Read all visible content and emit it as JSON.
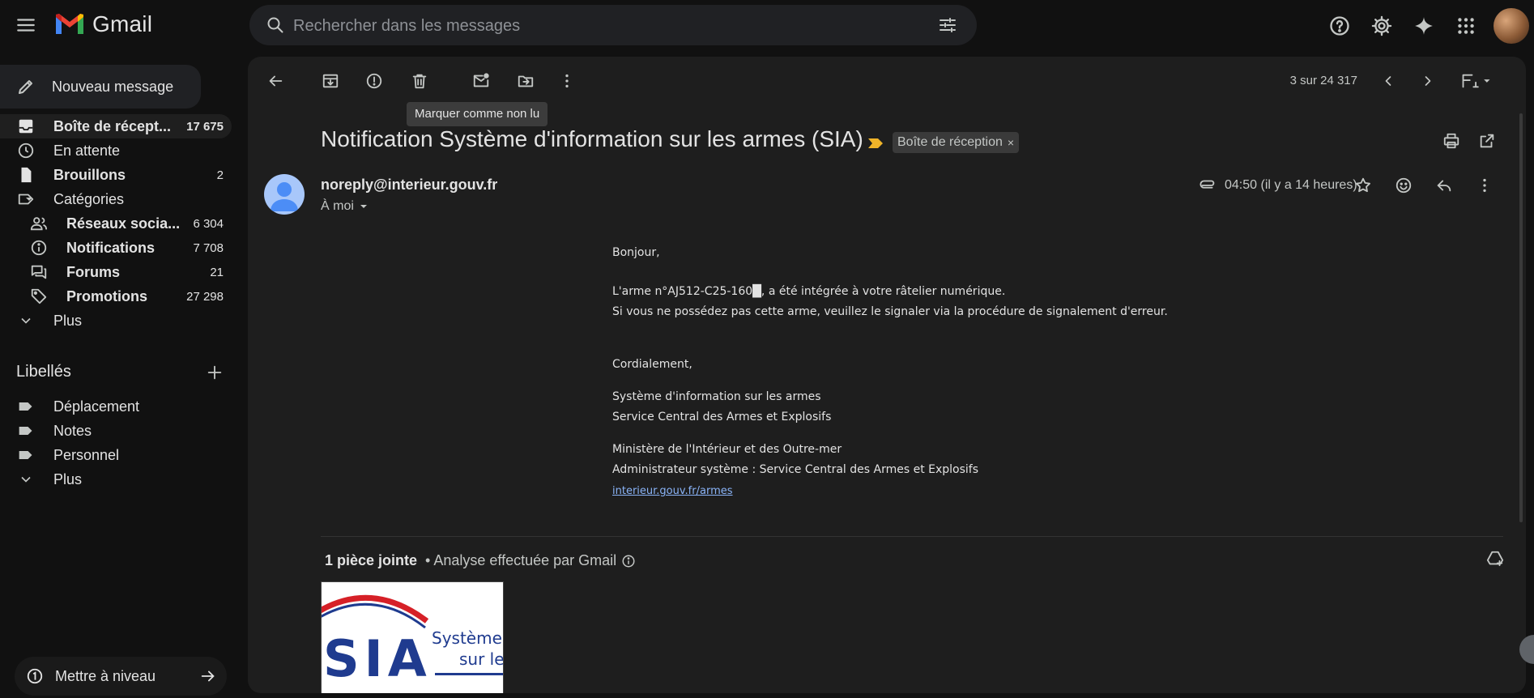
{
  "app": {
    "name": "Gmail"
  },
  "search": {
    "placeholder": "Rechercher dans les messages"
  },
  "sidebar": {
    "compose_label": "Nouveau message",
    "items": [
      {
        "label": "Boîte de récept...",
        "count": "17 675",
        "icon": "inbox-icon",
        "bold": true,
        "active": true
      },
      {
        "label": "En attente",
        "count": "",
        "icon": "clock-icon"
      },
      {
        "label": "Brouillons",
        "count": "2",
        "icon": "draft-icon",
        "bold": true
      },
      {
        "label": "Catégories",
        "count": "",
        "icon": "label-icon"
      },
      {
        "label": "Réseaux socia...",
        "count": "6 304",
        "icon": "people-icon",
        "bold": true
      },
      {
        "label": "Notifications",
        "count": "7 708",
        "icon": "info-icon",
        "bold": true
      },
      {
        "label": "Forums",
        "count": "21",
        "icon": "forum-icon",
        "bold": true
      },
      {
        "label": "Promotions",
        "count": "27 298",
        "icon": "tag-icon",
        "bold": true
      },
      {
        "label": "Plus",
        "count": "",
        "icon": "chevron-down-icon"
      }
    ],
    "labels_title": "Libellés",
    "labels": [
      {
        "label": "Déplacement"
      },
      {
        "label": "Notes"
      },
      {
        "label": "Personnel"
      },
      {
        "label": "Plus"
      }
    ],
    "upgrade_label": "Mettre à niveau"
  },
  "toolbar": {
    "pager": "3 sur 24 317",
    "tooltip": "Marquer comme non lu"
  },
  "email": {
    "subject": "Notification Système d'information sur les armes (SIA)",
    "chip": "Boîte de réception",
    "chip_close": "×",
    "sender": "noreply@interieur.gouv.fr",
    "to": "À moi",
    "time": "04:50 (il y a 14 heures)",
    "body": {
      "greeting": "Bonjour,",
      "line1": "L'arme n°AJ512-C25-160█, a été intégrée à votre râtelier numérique.",
      "line2": "Si vous ne possédez pas cette arme, veuillez le signaler via la procédure de signalement d'erreur.",
      "closing": "Cordialement,",
      "sig1": "Système d'information sur les armes",
      "sig2": "Service Central des Armes et Explosifs",
      "sig3": "Ministère de l'Intérieur et des Outre-mer",
      "sig4": "Administrateur système : Service Central des Armes et Explosifs",
      "link": "interieur.gouv.fr/armes"
    },
    "attachments": {
      "title": "1 pièce jointe",
      "scan": "• Analyse effectuée par Gmail",
      "thumb_text1": "SIA",
      "thumb_text2": "Système d'",
      "thumb_text3": "sur les"
    }
  },
  "colors": {
    "background": "#111111",
    "panel": "#1e1e1e",
    "link": "#8ab4f8",
    "importance": "#f0b429"
  }
}
